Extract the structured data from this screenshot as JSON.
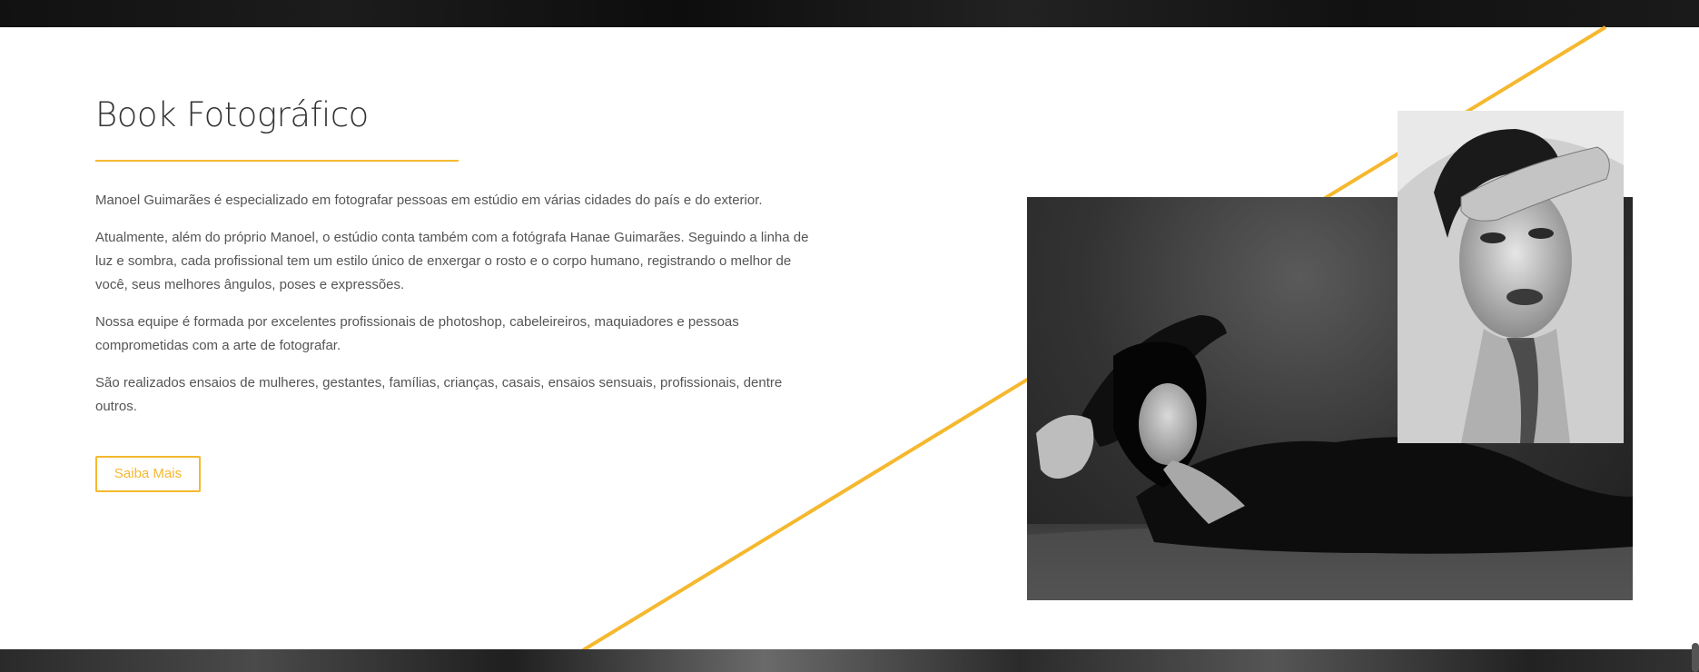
{
  "section": {
    "title": "Book Fotográfico",
    "paragraphs": [
      "Manoel Guimarães é especializado em fotografar pessoas em estúdio em várias cidades do país e do exterior.",
      "Atualmente, além do próprio Manoel, o estúdio conta também com a fotógrafa Hanae Guimarães. Seguindo a linha de luz e sombra, cada profissional tem um estilo único de enxergar o rosto e o corpo humano, registrando o melhor de você, seus melhores ângulos, poses e expressões.",
      "Nossa equipe é formada por excelentes profissionais de photoshop, cabeleireiros, maquiadores e pessoas comprometidas com a arte de fotografar.",
      "São realizados ensaios de mulheres, gestantes, famílias, crianças, casais, ensaios sensuais, profissionais, dentre outros."
    ],
    "button_label": "Saiba Mais"
  },
  "colors": {
    "accent": "#f5b82e",
    "text": "#555555",
    "heading": "#333333"
  }
}
